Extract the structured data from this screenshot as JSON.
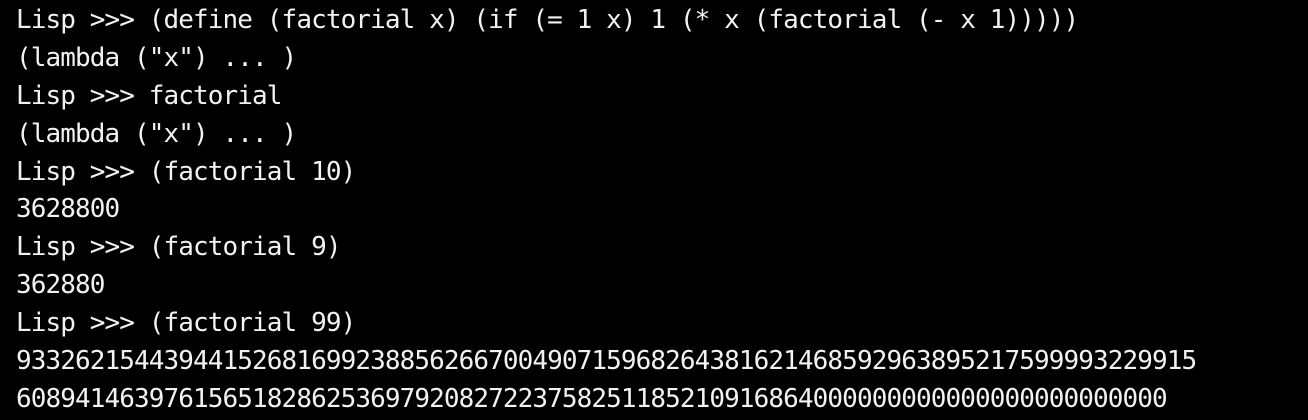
{
  "terminal": {
    "lines": [
      "Lisp >>> (define (factorial x) (if (= 1 x) 1 (* x (factorial (- x 1)))))",
      "(lambda (\"x\") ... )",
      "Lisp >>> factorial",
      "(lambda (\"x\") ... )",
      "Lisp >>> (factorial 10)",
      "3628800",
      "Lisp >>> (factorial 9)",
      "362880",
      "Lisp >>> (factorial 99)",
      "93326215443944152681699238856266700490715968264381621468592963895217599993229915",
      "608941463976156518286253697920827223758251185210916864000000000000000000000000"
    ]
  }
}
